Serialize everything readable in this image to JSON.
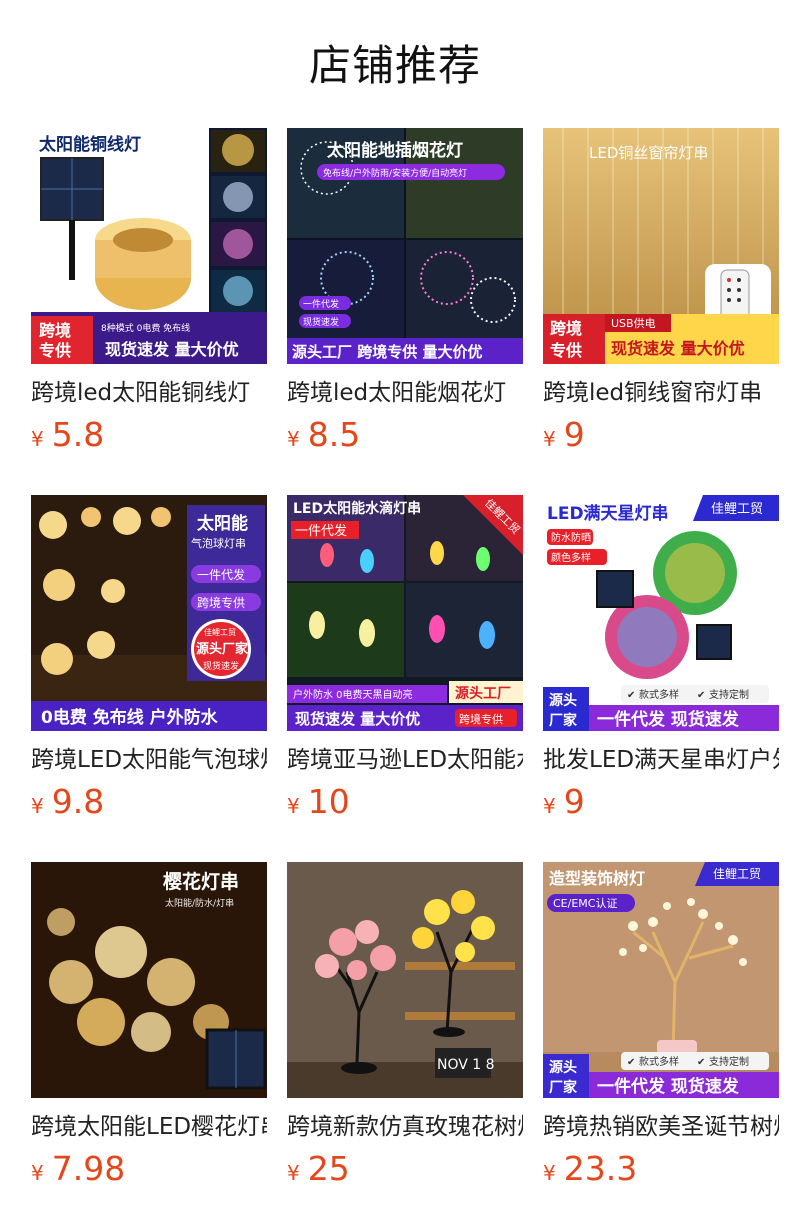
{
  "header": {
    "title": "店铺推荐"
  },
  "products": [
    {
      "name": "跨境led太阳能铜线灯",
      "currency": "¥",
      "price": "5.8",
      "banner": {
        "title": "太阳能铜线灯",
        "badge": "跨境专供",
        "mode_text": "8种模式 0电费 免布线",
        "bottom": "现货速发 量大价优"
      }
    },
    {
      "name": "跨境led太阳能烟花灯",
      "currency": "¥",
      "price": "8.5",
      "banner": {
        "title": "太阳能地插烟花灯",
        "subtitle": "免布线/户外防雨/安装方便/自动亮灯",
        "tag1": "一件代发",
        "tag2": "现货速发",
        "bottom": "源头工厂 跨境专供 量大价优"
      }
    },
    {
      "name": "跨境led铜线窗帘灯串",
      "currency": "¥",
      "price": "9",
      "banner": {
        "title": "LED铜丝窗帘灯串",
        "badge": "跨境专供",
        "usb": "USB供电",
        "bottom": "现货速发 量大价优"
      }
    },
    {
      "name": "跨境LED太阳能气泡球灯串",
      "currency": "¥",
      "price": "9.8",
      "banner": {
        "title": "太阳能",
        "subtitle": "气泡球灯串",
        "tag1": "一件代发",
        "tag2": "跨境专供",
        "seal": "佳鲤工贸",
        "seal2": "源头厂家",
        "seal3": "现货速发",
        "bottom": "0电费 免布线 户外防水"
      }
    },
    {
      "name": "跨境亚马逊LED太阳能水滴灯串",
      "currency": "¥",
      "price": "10",
      "banner": {
        "title": "LED太阳能水滴灯串",
        "tag1": "一件代发",
        "corner": "佳鲤工贸",
        "line": "户外防水 0电费天黑自动亮",
        "factory": "源头工厂",
        "bottom": "现货速发 量大价优",
        "cross": "跨境专供"
      }
    },
    {
      "name": "批发LED满天星串灯户外",
      "currency": "¥",
      "price": "9",
      "banner": {
        "title": "LED满天星灯串",
        "corner": "佳鲤工贸",
        "tag1": "防水防晒",
        "tag2": "颜色多样",
        "check1": "款式多样",
        "check2": "支持定制",
        "badge": "源头厂家",
        "bottom": "一件代发 现货速发"
      }
    },
    {
      "name": "跨境太阳能LED樱花灯串",
      "currency": "¥",
      "price": "7.98",
      "banner": {
        "title": "樱花灯串",
        "subtitle": "太阳能/防水/灯串"
      }
    },
    {
      "name": "跨境新款仿真玫瑰花树灯",
      "currency": "¥",
      "price": "25",
      "banner": {
        "clock": "NOV 1 8"
      }
    },
    {
      "name": "跨境热销欧美圣诞节树灯",
      "currency": "¥",
      "price": "23.3",
      "banner": {
        "title": "造型装饰树灯",
        "corner": "佳鲤工贸",
        "tag1": "CE/EMC认证",
        "check1": "款式多样",
        "check2": "支持定制",
        "badge": "源头厂家",
        "bottom": "一件代发 现货速发"
      }
    }
  ],
  "colors": {
    "price": "#e4471b",
    "brand_purple": "#6a2bd6",
    "brand_red": "#d8202a"
  }
}
